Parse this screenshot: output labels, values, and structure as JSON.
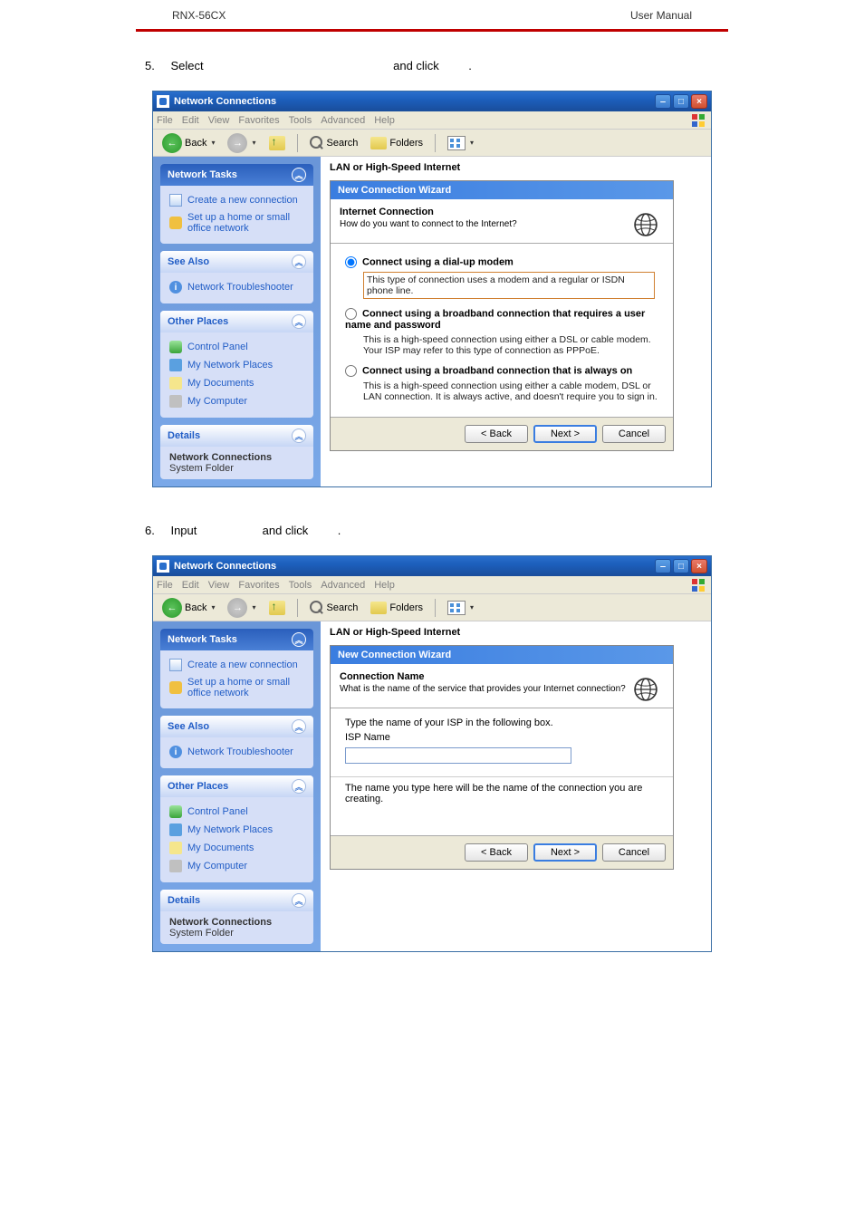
{
  "doc": {
    "header_left": "RNX-56CX",
    "header_right": "User  Manual",
    "step5": "5.",
    "step5_txt1": "Select",
    "step5_txt2": "and click",
    "step5_txt3": ".",
    "step6": "6.",
    "step6_txt1": "Input",
    "step6_txt2": "and click",
    "step6_txt3": "."
  },
  "win": {
    "title": "Network Connections",
    "menu": {
      "file": "File",
      "edit": "Edit",
      "view": "View",
      "fav": "Favorites",
      "tools": "Tools",
      "adv": "Advanced",
      "help": "Help"
    },
    "tb": {
      "back": "Back",
      "search": "Search",
      "folders": "Folders"
    },
    "section": "LAN or High-Speed Internet"
  },
  "side": {
    "tasks": {
      "title": "Network Tasks",
      "a": "Create a new connection",
      "b": "Set up a home or small office network"
    },
    "see": {
      "title": "See Also",
      "a": "Network Troubleshooter"
    },
    "other": {
      "title": "Other Places",
      "a": "Control Panel",
      "b": "My Network Places",
      "c": "My Documents",
      "d": "My Computer"
    },
    "details": {
      "title": "Details",
      "a": "Network Connections",
      "b": "System Folder"
    }
  },
  "wiz1": {
    "head": "New Connection Wizard",
    "sub_t": "Internet Connection",
    "sub_d": "How do you want to connect to the Internet?",
    "r1_l": "Connect using a dial-up modem",
    "r1_d": "This type of connection uses a modem and a regular or ISDN phone line.",
    "r2_l": "Connect using a broadband connection that requires a user name and password",
    "r2_d": "This is a high-speed connection using either a DSL or cable modem. Your ISP may refer to this type of connection as PPPoE.",
    "r3_l": "Connect using a broadband connection that is always on",
    "r3_d": "This is a high-speed connection using either a cable modem, DSL or LAN connection. It is always active, and doesn't require you to sign in.",
    "back": "< Back",
    "next": "Next >",
    "cancel": "Cancel"
  },
  "wiz2": {
    "head": "New Connection Wizard",
    "sub_t": "Connection Name",
    "sub_d": "What is the name of the service that provides your Internet connection?",
    "label": "Type the name of your ISP in the following box.",
    "isp": "ISP Name",
    "note": "The name you type here will be the name of the connection you are creating.",
    "back": "< Back",
    "next": "Next >",
    "cancel": "Cancel"
  },
  "chevron": "︽"
}
